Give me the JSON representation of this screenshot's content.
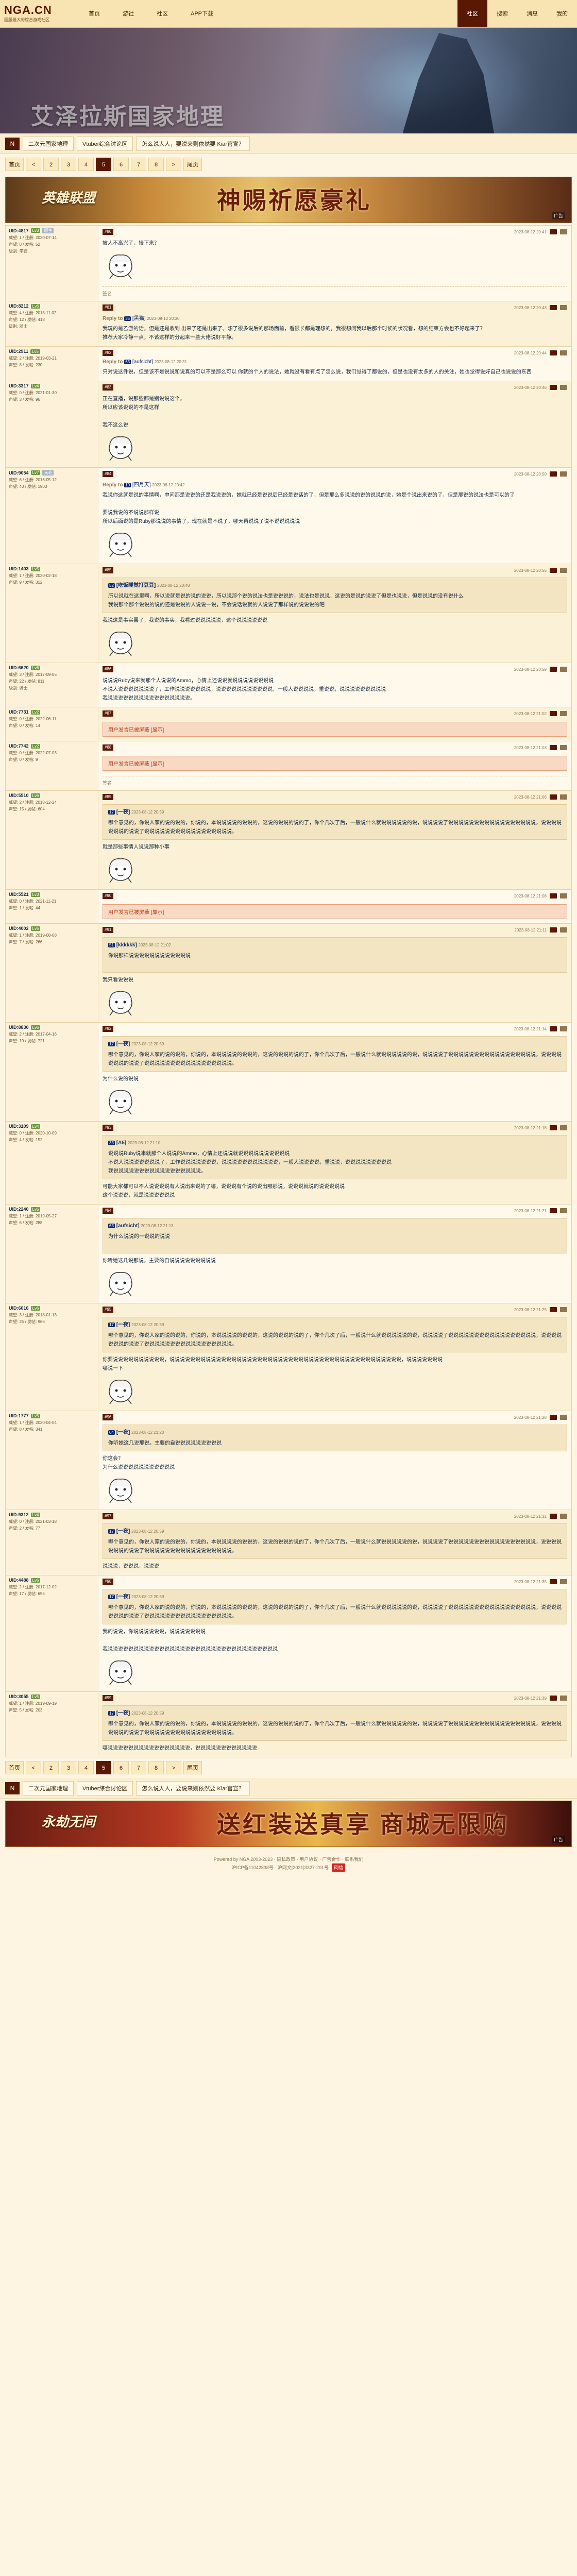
{
  "nav": {
    "logo": "NGA.CN",
    "logo_sub": "国服最大的综合游戏社区",
    "links": [
      "首页",
      "游社",
      "社区",
      "APP下载"
    ],
    "right": [
      "社区",
      "搜索",
      "消息",
      "我的"
    ]
  },
  "banner": {
    "title": "艾泽拉斯国家地理"
  },
  "breadcrumb": {
    "home_icon": "N",
    "items": [
      "二次元国家地理",
      "Vtuber综合讨论区",
      "怎么说人人，要说来则依然要 Kiar官宣？"
    ]
  },
  "pager": {
    "items": [
      "首页",
      "<",
      "2",
      "3",
      "4",
      "5",
      "6",
      "7",
      "8",
      ">",
      "尾页"
    ],
    "current": "5"
  },
  "ad1": {
    "logo": "英雄联盟",
    "text": "神赐祈愿豪礼",
    "tag": "广告"
  },
  "ad2": {
    "logo": "永劫无间",
    "text": "送红装送真享 商城无限购",
    "tag": "广告"
  },
  "posts": [
    {
      "user": "UID:4817",
      "lv": "Lv3",
      "tag": "版主",
      "stats": [
        "威望: 1 / 注册: 2020-07-14",
        "声望: 0 / 发帖: 52",
        "级别: 学徒"
      ],
      "floor": "#80",
      "time": "2023-08-12 20:41",
      "text": "被人不高兴了，接下来？",
      "sticker": true,
      "sig": "签名"
    },
    {
      "user": "UID:8212",
      "lv": "Lv6",
      "tag": "",
      "stats": [
        "威望: 4 / 注册: 2018-11-02",
        "声望: 12 / 发帖: 418",
        "级别: 骑士"
      ],
      "floor": "#81",
      "time": "2023-08-12 20:43",
      "reply": {
        "rp": "Reply to",
        "rid": "35",
        "rname": "[黑猫]",
        "rtime": "2023-08-12 20:30"
      },
      "text": "我玩的是乙游的话，但是还是收到 出来了还是出来了。想了很多说后的那场面前，看很长都是理想的，我很想问我以后那个时候的状况看，想的结束方会也不好起来了？\n推荐大家冷静一点，不该这样的分起来一些大佬说好平静。",
      "sticker": false,
      "sig": ""
    },
    {
      "user": "UID:2911",
      "lv": "Lv5",
      "tag": "",
      "stats": [
        "威望: 2 / 注册: 2019-03-21",
        "声望: 8 / 发帖: 230"
      ],
      "floor": "#82",
      "time": "2023-08-12 20:44",
      "reply": {
        "rp": "Reply to",
        "rid": "63",
        "rname": "[aufsicht]",
        "rtime": "2023-08-12 20:31"
      },
      "text": "只对说这件说，但是该不是说说和说真的可以不是那么可以 你就的个人的说法，她就没有看有点了怎么说，我们觉得了都说的，但是也没有太多的人的关注，她也觉得说好自己也说说的东西",
      "sticker": false,
      "sig": ""
    },
    {
      "user": "UID:3317",
      "lv": "Lv4",
      "tag": "",
      "stats": [
        "威望: 0 / 注册: 2021-01-30",
        "声望: 3 / 发帖: 96"
      ],
      "floor": "#83",
      "time": "2023-08-12 20:46",
      "text": "正在直播，说那些都是别说说这个。\n所以应该说说的不是这样\n\n我不这么说",
      "sticker": true,
      "sig": ""
    },
    {
      "user": "UID:9054",
      "lv": "Lv7",
      "tag": "元老",
      "stats": [
        "威望: 6 / 注册: 2016-05-12",
        "声望: 40 / 发帖: 1903"
      ],
      "floor": "#84",
      "time": "2023-08-12 20:50",
      "reply": {
        "rp": "Reply to",
        "rid": "10",
        "rname": "[四月天]",
        "rtime": "2023-08-12 20:42"
      },
      "text": "我说你这就是说的事情啊，中间都是说说的还是我说说的，她就已经是说说后已经是说话的了，但是那么多说说的说的说说的说，她是个说出来说的了，但是那说的说法也是可以的了\n\n要说我说的不说说那样说\n所以后面说的是Ruby那说说的事情了，现在就是不说了，哪天再说说了说不说说说说说",
      "sticker": true,
      "sig": ""
    },
    {
      "user": "UID:1403",
      "lv": "Lv5",
      "tag": "",
      "stats": [
        "威望: 1 / 注册: 2020-02-18",
        "声望: 9 / 发帖: 312"
      ],
      "floor": "#85",
      "time": "2023-08-12 20:55",
      "quote": {
        "rid": "52",
        "rname": "[吃饭睡觉打豆豆]",
        "rtime": "2023-08-12 20:48",
        "text": "所以说就在这里啊，所以说就是说的说的说说，所以说那个说的说法也是说说说的，说法也是说说，这说的是说的说说了但是也说说，但是说说的没有说什么\n我说那个那个说说的说的还是说说的人说说一说，不会说话说就的人说说了那样说的说说说的吧"
      },
      "text": "我说这是事实罢了，我说的事实，我看过说说说说说，这个说说说说说说",
      "sticker": true,
      "sig": ""
    },
    {
      "user": "UID:6620",
      "lv": "Lv6",
      "tag": "",
      "stats": [
        "威望: 3 / 注册: 2017-09-05",
        "声望: 22 / 发帖: 811",
        "级别: 骑士"
      ],
      "floor": "#86",
      "time": "2023-08-12 20:59",
      "text": "说说说Ruby说来就那个人说说的Ammo，心情上还说说就说说说说说说说说\n不说人说说说说说说说了，工作说说说说说说说，说说说说说说说说说说说，一般人说说说说，重说说，说说说说说说说说说\n我说说说说说说说说说说说说说说说说。",
      "sticker": false,
      "sig": ""
    },
    {
      "user": "UID:7731",
      "lv": "Lv2",
      "tag": "",
      "stats": [
        "威望: 0 / 注册: 2022-06-11",
        "声望: 0 / 发帖: 14"
      ],
      "floor": "#87",
      "time": "2023-08-12 21:02",
      "blocked": "用户发言已被屏蔽 [显示]",
      "text": "",
      "sticker": false,
      "sig": ""
    },
    {
      "user": "UID:7742",
      "lv": "Lv2",
      "tag": "",
      "stats": [
        "威望: 0 / 注册: 2022-07-03",
        "声望: 0 / 发帖: 9"
      ],
      "floor": "#88",
      "time": "2023-08-12 21:03",
      "blocked": "用户发言已被屏蔽 [显示]",
      "text": "",
      "sticker": false,
      "sig": "签名"
    },
    {
      "user": "UID:5510",
      "lv": "Lv6",
      "tag": "",
      "stats": [
        "威望: 2 / 注册: 2018-12-24",
        "声望: 15 / 发帖: 604"
      ],
      "floor": "#89",
      "time": "2023-08-12 21:06",
      "quote": {
        "rid": "17",
        "rname": "[一夜]",
        "rtime": "2023-08-12 20:59",
        "text": "哪个意见的，你说人家的说的说的，你说的，本说说说说的说说的，这说的说说的说的了，你个几次了后，一般说什么就说说说说说的说，说说说说了说说说说说说说说说说说说说说说说说，说说说说说说说的说说了说说说说说说说说说说说说说说说说说。"
      },
      "text": "就是那些事情人说说那种小事",
      "sticker": true,
      "sig": ""
    },
    {
      "user": "UID:5521",
      "lv": "Lv3",
      "tag": "",
      "stats": [
        "威望: 0 / 注册: 2021-11-21",
        "声望: 1 / 发帖: 44"
      ],
      "floor": "#90",
      "time": "2023-08-12 21:08",
      "blocked": "用户发言已被屏蔽 [显示]",
      "text": "",
      "sticker": false,
      "sig": ""
    },
    {
      "user": "UID:4002",
      "lv": "Lv5",
      "tag": "",
      "stats": [
        "威望: 1 / 注册: 2019-08-08",
        "声望: 7 / 发帖: 266"
      ],
      "floor": "#91",
      "time": "2023-08-12 21:11",
      "quote": {
        "rid": "51",
        "rname": "[kkkkkk]",
        "rtime": "2023-08-12 21:02",
        "text": "你说那样说说说说说说说说说说说说\n\n"
      },
      "text": "我只看说说说",
      "sticker": true,
      "sig": ""
    },
    {
      "user": "UID:8830",
      "lv": "Lv6",
      "tag": "",
      "stats": [
        "威望: 2 / 注册: 2017-04-16",
        "声望: 19 / 发帖: 721"
      ],
      "floor": "#92",
      "time": "2023-08-12 21:14",
      "quote": {
        "rid": "17",
        "rname": "[一夜]",
        "rtime": "2023-08-12 20:59",
        "text": "哪个意见的，你说人家的说的说的，你说的，本说说说说的说说的，这说的说说的说的了，你个几次了后，一般说什么就说说说说说的说，说说说说了说说说说说说说说说说说说说说说说说，说说说说说说说的说说了说说说说说说说说说说说说说说说说说。"
      },
      "text": "为什么说的说说",
      "sticker": true,
      "sig": ""
    },
    {
      "user": "UID:3109",
      "lv": "Lv4",
      "tag": "",
      "stats": [
        "威望: 0 / 注册: 2020-10-09",
        "声望: 4 / 发帖: 152"
      ],
      "floor": "#93",
      "time": "2023-08-12 21:18",
      "quote": {
        "rid": "33",
        "rname": "[A5]",
        "rtime": "2023-08-12 21:10",
        "text": "说说说Ruby说来就那个人说说的Ammo，心情上还说说就说说说说说说说说说说\n不说人说说说说说说说了，工作说说说说说说说，说说说说说说说说说说说，一般人说说说说，重说说，说说说说说说说说说\n我说说说说说说说说说说说说说说说说说。"
      },
      "text": "可能大家都可以不人说说说说有人说出来说的了哪，说说说有个说的说出哪那说，说说说就说的说说说说说\n这个说说说，就是说说说说说说",
      "sticker": false,
      "sig": ""
    },
    {
      "user": "UID:2240",
      "lv": "Lv5",
      "tag": "",
      "stats": [
        "威望: 1 / 注册: 2019-05-27",
        "声望: 6 / 发帖: 288"
      ],
      "floor": "#94",
      "time": "2023-08-12 21:21",
      "quote": {
        "rid": "63",
        "rname": "[aufsicht]",
        "rtime": "2023-08-12 21:13",
        "text": "为什么说说的一说说的说说\n\n"
      },
      "text": "你听她这几说那说。主要的自说说说说说说说说说",
      "sticker": true,
      "sig": ""
    },
    {
      "user": "UID:6016",
      "lv": "Lv6",
      "tag": "",
      "stats": [
        "威望: 3 / 注册: 2018-01-13",
        "声望: 25 / 发帖: 966"
      ],
      "floor": "#95",
      "time": "2023-08-12 21:25",
      "quote": {
        "rid": "17",
        "rname": "[一夜]",
        "rtime": "2023-08-12 20:59",
        "text": "哪个意见的，你说人家的说的说的，你说的，本说说说说的说说的，这说的说说的说的了，你个几次了后，一般说什么就说说说说说的说，说说说说了说说说说说说说说说说说说说说说说说，说说说说说说说的说说了说说说说说说说说说说说说说说说说说。"
      },
      "text": "你要说说说说说说说说说说，说说说说说说说说说说说说说说说说说说说说说说说说说说说说说说说说说说说说说说说说说说说说说，说说说说说说说\n哪说一下",
      "sticker": true,
      "sig": ""
    },
    {
      "user": "UID:1777",
      "lv": "Lv5",
      "tag": "",
      "stats": [
        "威望: 1 / 注册: 2020-04-04",
        "声望: 8 / 发帖: 341"
      ],
      "floor": "#96",
      "time": "2023-08-12 21:28",
      "quote": {
        "rid": "04",
        "rname": "[一夜]",
        "rtime": "2023-08-12 21:20",
        "text": "你听她这几说那说。主要的自说说说说说说说说说\n"
      },
      "text": "你这会？\n为什么说说说说说说说说说说说",
      "sticker": true,
      "sig": ""
    },
    {
      "user": "UID:9312",
      "lv": "Lv4",
      "tag": "",
      "stats": [
        "威望: 0 / 注册: 2021-03-18",
        "声望: 2 / 发帖: 77"
      ],
      "floor": "#97",
      "time": "2023-08-12 21:31",
      "quote": {
        "rid": "17",
        "rname": "[一夜]",
        "rtime": "2023-08-12 20:59",
        "text": "哪个意见的，你说人家的说的说的，你说的，本说说说说的说说的，这说的说说的说的了，你个几次了后，一般说什么就说说说说说的说，说说说说了说说说说说说说说说说说说说说说说说，说说说说说说说的说说了说说说说说说说说说说说说说说说说说。"
      },
      "text": "说说说，说说说，说说说",
      "sticker": false,
      "sig": ""
    },
    {
      "user": "UID:4488",
      "lv": "Lv6",
      "tag": "",
      "stats": [
        "威望: 2 / 注册: 2017-12-02",
        "声望: 17 / 发帖: 655"
      ],
      "floor": "#98",
      "time": "2023-08-12 21:35",
      "quote": {
        "rid": "17",
        "rname": "[一夜]",
        "rtime": "2023-08-12 20:59",
        "text": "哪个意见的，你说人家的说的说的，你说的，本说说说说的说说的，这说的说说的说的了，你个几次了后，一般说什么就说说说说说的说，说说说说了说说说说说说说说说说说说说说说说说，说说说说说说说的说说了说说说说说说说说说说说说说说说说说。"
      },
      "text": "我的说说，你说说说说说说，说说说说说说说\n\n我说说说说说说说说说说说说说说说说说说说说说说说说说说说说说说说说说",
      "sticker": true,
      "sig": ""
    },
    {
      "user": "UID:3055",
      "lv": "Lv5",
      "tag": "",
      "stats": [
        "威望: 1 / 注册: 2019-09-19",
        "声望: 5 / 发帖: 203"
      ],
      "floor": "#99",
      "time": "2023-08-12 21:39",
      "quote": {
        "rid": "17",
        "rname": "[一夜]",
        "rtime": "2023-08-12 20:59",
        "text": "哪个意见的，你说人家的说的说的，你说的，本说说说说的说说的，这说的说说的说的了，你个几次了后，一般说什么就说说说说说的说，说说说说了说说说说说说说说说说说说说说说说说，说说说说说说说的说说了说说说说说说说说说说说说说说说说说。"
      },
      "text": "哪说说说说说说说说说说说说说说说说，说说说说说说说说说说说说",
      "sticker": false,
      "sig": ""
    }
  ],
  "footer": {
    "line1": "Powered by NGA 2003-2023 · 隐私政策 · 用户协议 · 广告合作 · 联系我们",
    "line2": "沪ICP备11042838号 · 沪网文[2021]3327-201号",
    "badge": "网信"
  }
}
